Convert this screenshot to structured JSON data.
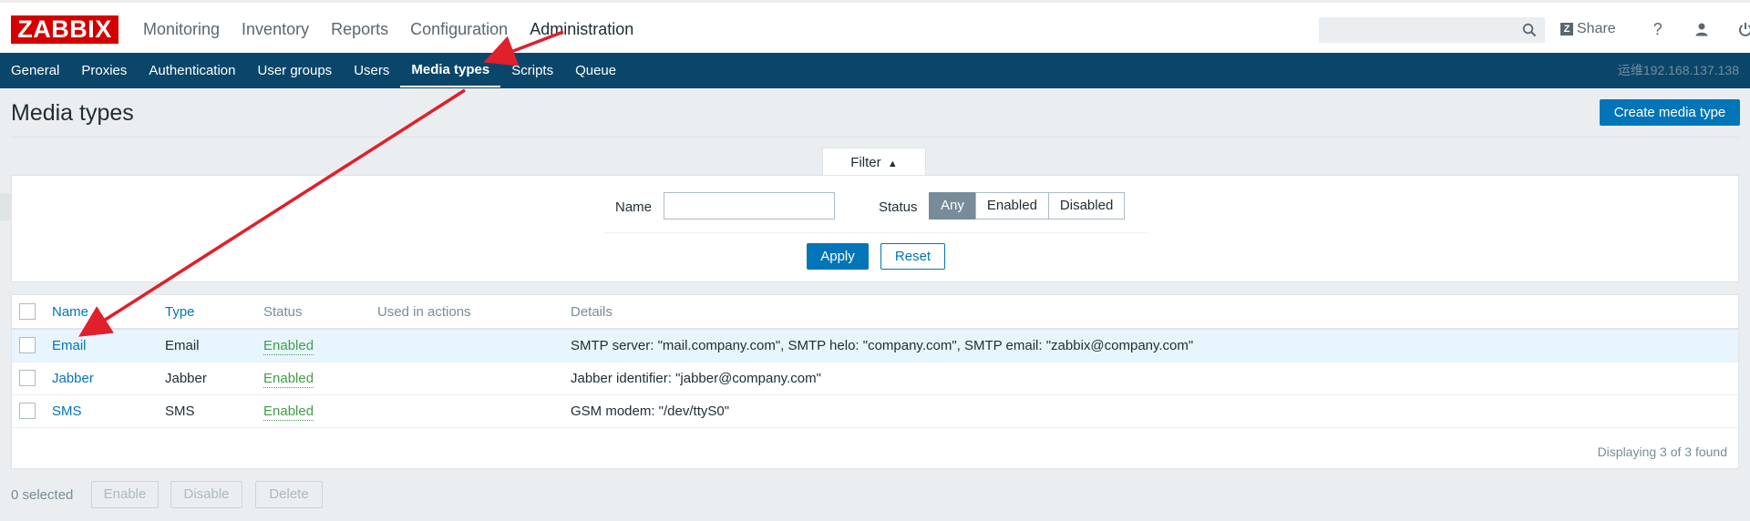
{
  "header": {
    "logo": "ZABBIX",
    "menu": [
      {
        "label": "Monitoring"
      },
      {
        "label": "Inventory"
      },
      {
        "label": "Reports"
      },
      {
        "label": "Configuration"
      },
      {
        "label": "Administration",
        "active": true
      }
    ],
    "search": {
      "value": "",
      "placeholder": ""
    },
    "share_label": "Share",
    "help_glyph": "?"
  },
  "subnav": {
    "items": [
      {
        "label": "General"
      },
      {
        "label": "Proxies"
      },
      {
        "label": "Authentication"
      },
      {
        "label": "User groups"
      },
      {
        "label": "Users"
      },
      {
        "label": "Media types",
        "active": true
      },
      {
        "label": "Scripts"
      },
      {
        "label": "Queue"
      }
    ],
    "server": "运维192.168.137.138"
  },
  "page": {
    "title": "Media types",
    "create_button": "Create media type"
  },
  "filter": {
    "tab_label": "Filter",
    "tab_arrow": "▲",
    "name_label": "Name",
    "name_value": "",
    "status_label": "Status",
    "status_options": [
      "Any",
      "Enabled",
      "Disabled"
    ],
    "status_selected": "Any",
    "apply": "Apply",
    "reset": "Reset"
  },
  "table": {
    "headers": {
      "name": "Name",
      "sort_arrow": "▲",
      "type": "Type",
      "status": "Status",
      "used_in_actions": "Used in actions",
      "details": "Details"
    },
    "rows": [
      {
        "name": "Email",
        "type": "Email",
        "status": "Enabled",
        "used_in_actions": "",
        "details": "SMTP server: \"mail.company.com\", SMTP helo: \"company.com\", SMTP email: \"zabbix@company.com\""
      },
      {
        "name": "Jabber",
        "type": "Jabber",
        "status": "Enabled",
        "used_in_actions": "",
        "details": "Jabber identifier: \"jabber@company.com\""
      },
      {
        "name": "SMS",
        "type": "SMS",
        "status": "Enabled",
        "used_in_actions": "",
        "details": "GSM modem: \"/dev/ttyS0\""
      }
    ],
    "footer": "Displaying 3 of 3 found"
  },
  "actions": {
    "selected": "0 selected",
    "enable": "Enable",
    "disable": "Disable",
    "delete": "Delete"
  },
  "colors": {
    "nav_bg": "#0a466a",
    "primary": "#0275b8",
    "enabled": "#429e47",
    "logo": "#d40000",
    "annotation_arrow": "#e0202a"
  }
}
